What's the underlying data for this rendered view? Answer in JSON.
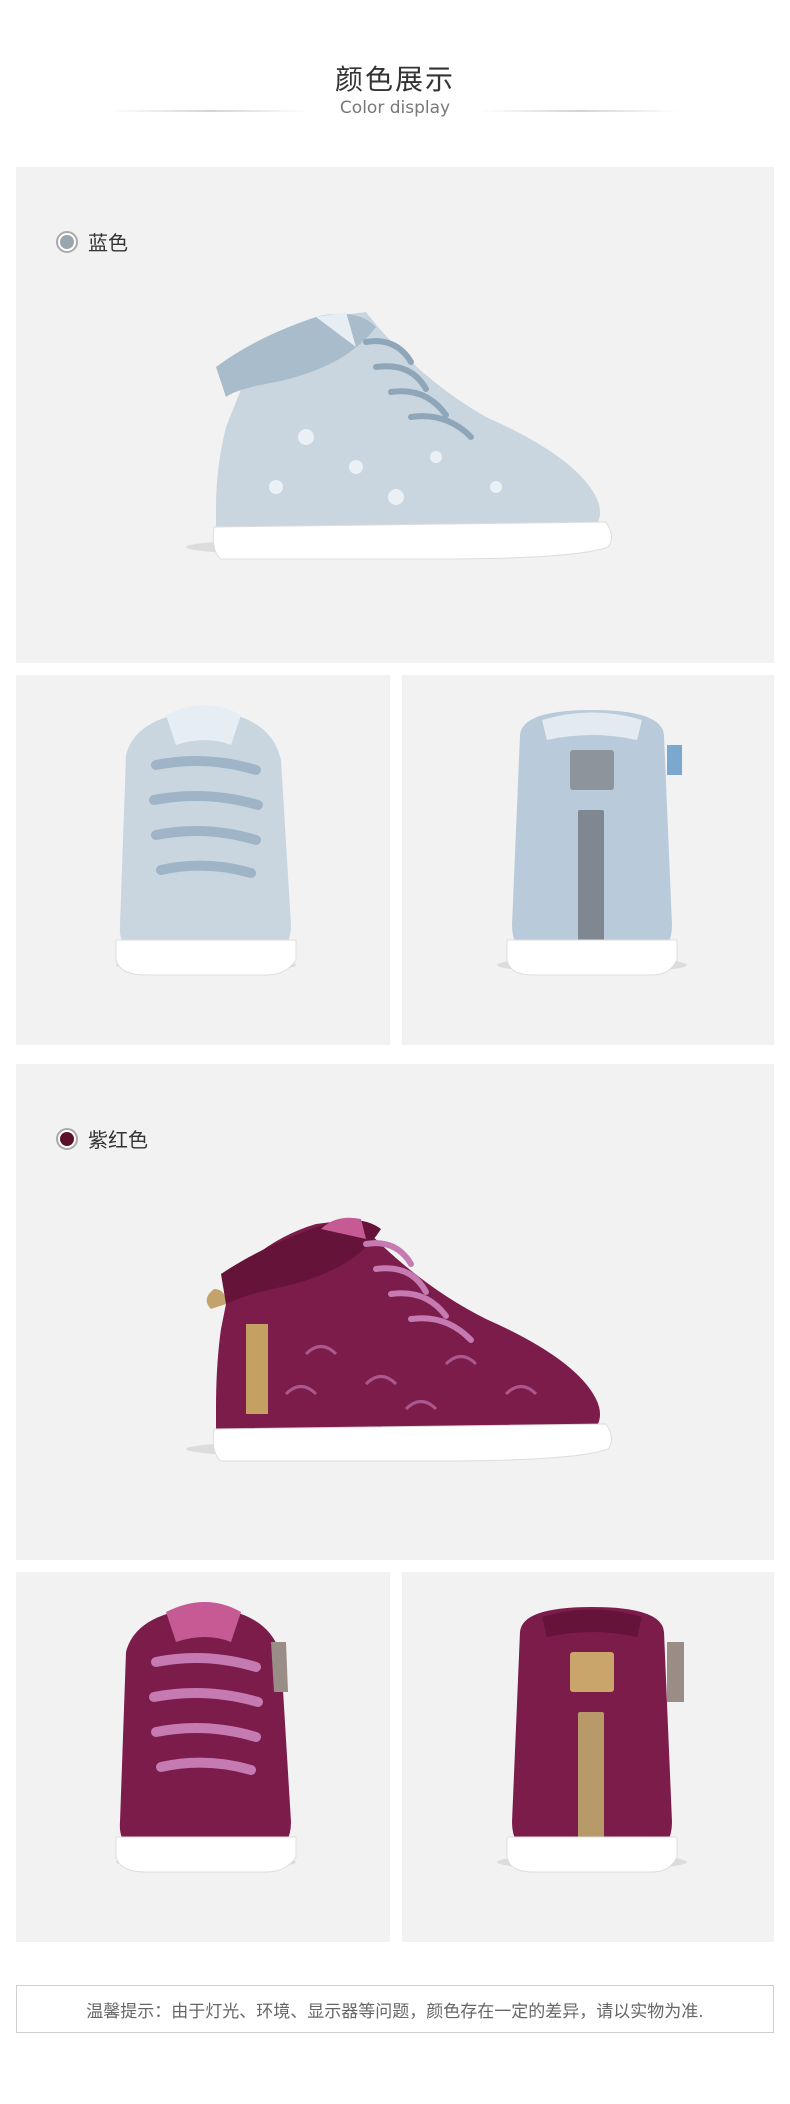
{
  "header": {
    "title_cn": "颜色展示",
    "title_en": "Color display"
  },
  "colors": [
    {
      "label": "蓝色",
      "swatch": "#9aa6ad",
      "shoe_main": "#c9d6e0",
      "shoe_dark": "#a9bccb",
      "accent": "#b7c9db"
    },
    {
      "label": "紫红色",
      "swatch": "#5c1029",
      "shoe_main": "#7b1c4a",
      "shoe_dark": "#651339",
      "accent": "#c57ab2"
    }
  ],
  "note": {
    "text": "温馨提示：由于灯光、环境、显示器等问题，颜色存在一定的差异，请以实物为准."
  }
}
